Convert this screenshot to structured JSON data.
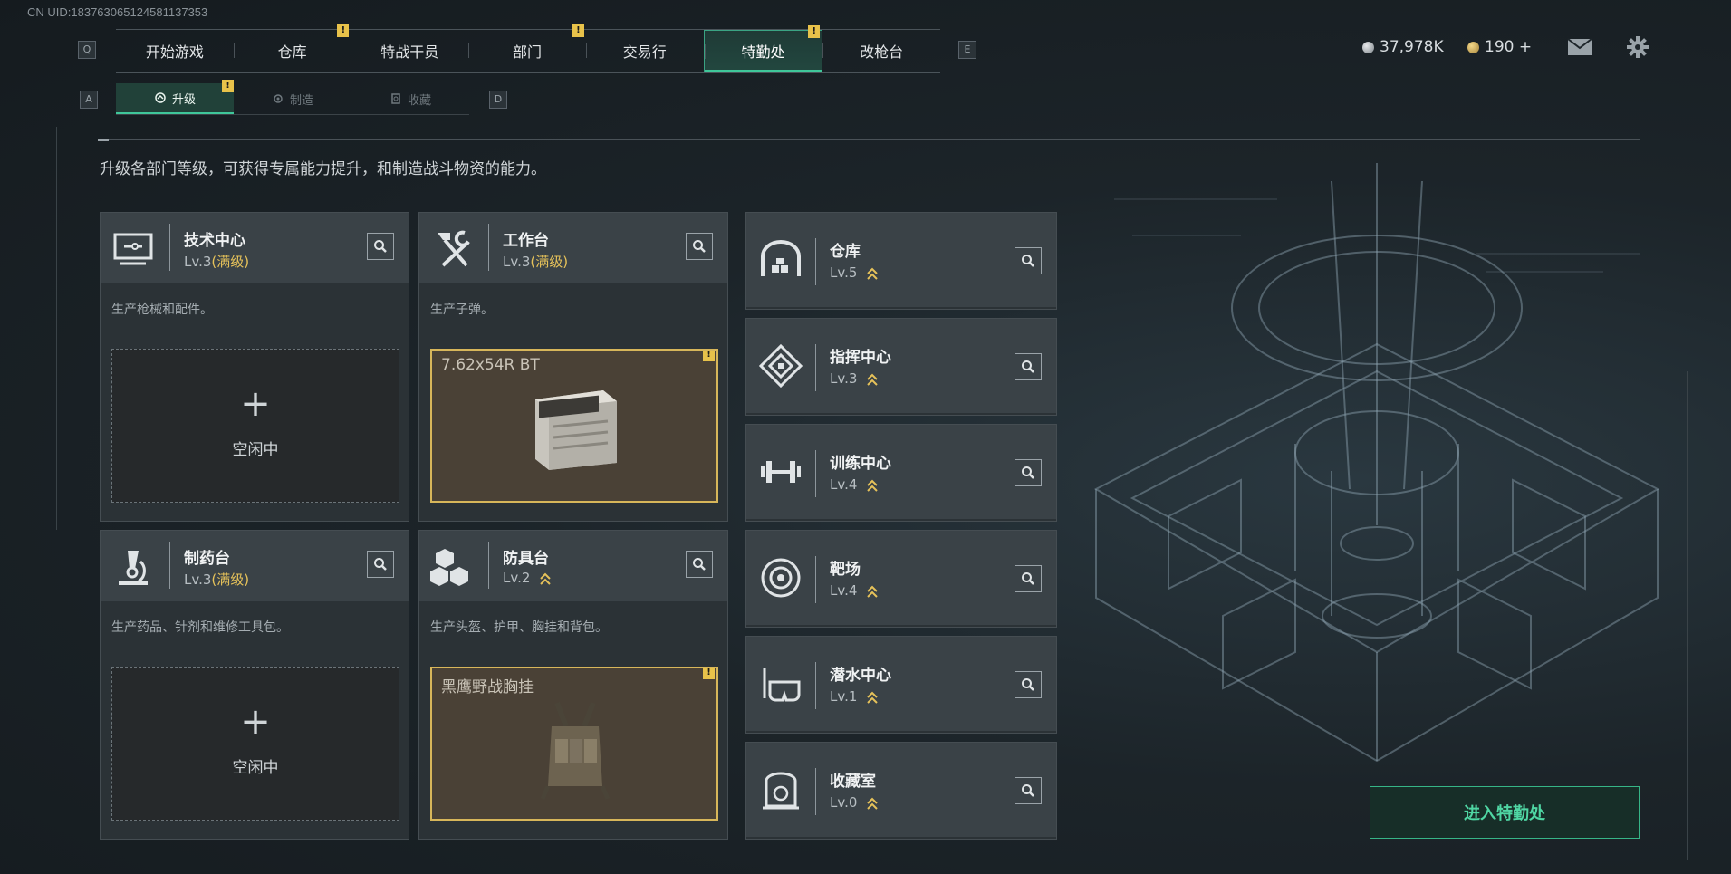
{
  "uid": "CN UID:1837630651245811373​53",
  "keys": {
    "left_tab": "Q",
    "right_tab": "E",
    "left_sub": "A",
    "right_sub": "D"
  },
  "topnav": [
    {
      "label": "开始游戏",
      "active": false,
      "alert": false
    },
    {
      "label": "仓库",
      "active": false,
      "alert": true
    },
    {
      "label": "特战干员",
      "active": false,
      "alert": false
    },
    {
      "label": "部门",
      "active": false,
      "alert": true
    },
    {
      "label": "交易行",
      "active": false,
      "alert": false
    },
    {
      "label": "特勤处",
      "active": true,
      "alert": true
    },
    {
      "label": "改枪台",
      "active": false,
      "alert": false
    }
  ],
  "subnav": [
    {
      "label": "升级",
      "active": true,
      "alert": true,
      "icon": "upgrade-icon"
    },
    {
      "label": "制造",
      "active": false,
      "alert": false,
      "icon": "gear-icon"
    },
    {
      "label": "收藏",
      "active": false,
      "alert": false,
      "icon": "collection-icon"
    }
  ],
  "resources": {
    "currency": "37,978K",
    "premium": "190 +"
  },
  "alert_mark": "!",
  "description": "升级各部门等级，可获得专属能力提升，和制造战斗物资的能力。",
  "large_cards": [
    {
      "name": "技术中心",
      "level": "Lv.3",
      "max": "(满级)",
      "desc": "生产枪械和配件。",
      "state": "idle",
      "plus": "+",
      "idle_text": "空闲中",
      "icon": "computer-icon"
    },
    {
      "name": "工作台",
      "level": "Lv.3",
      "max": "(满级)",
      "desc": "生产子弹。",
      "state": "producing",
      "product": "7.62x54R BT",
      "icon": "hammer-wrench-icon"
    },
    {
      "name": "制药台",
      "level": "Lv.3",
      "max": "(满级)",
      "desc": "生产药品、针剂和维修工具包。",
      "state": "idle",
      "plus": "+",
      "idle_text": "空闲中",
      "icon": "microscope-icon"
    },
    {
      "name": "防具台",
      "level": "Lv.2",
      "max": "",
      "desc": "生产头盔、护甲、胸挂和背包。",
      "state": "producing",
      "product": "黑鹰野战胸挂",
      "icon": "cubes-icon"
    }
  ],
  "small_cards": [
    {
      "name": "仓库",
      "level": "Lv.5",
      "icon": "warehouse-icon"
    },
    {
      "name": "指挥中心",
      "level": "Lv.3",
      "icon": "command-icon"
    },
    {
      "name": "训练中心",
      "level": "Lv.4",
      "icon": "dumbbell-icon"
    },
    {
      "name": "靶场",
      "level": "Lv.4",
      "icon": "target-icon"
    },
    {
      "name": "潜水中心",
      "level": "Lv.1",
      "icon": "diving-mask-icon"
    },
    {
      "name": "收藏室",
      "level": "Lv.0",
      "icon": "vault-icon"
    }
  ],
  "enter_button": "进入特勤处",
  "colors": {
    "accent": "#3fc79a",
    "gold": "#e6c25a",
    "panel": "#3a4247"
  }
}
